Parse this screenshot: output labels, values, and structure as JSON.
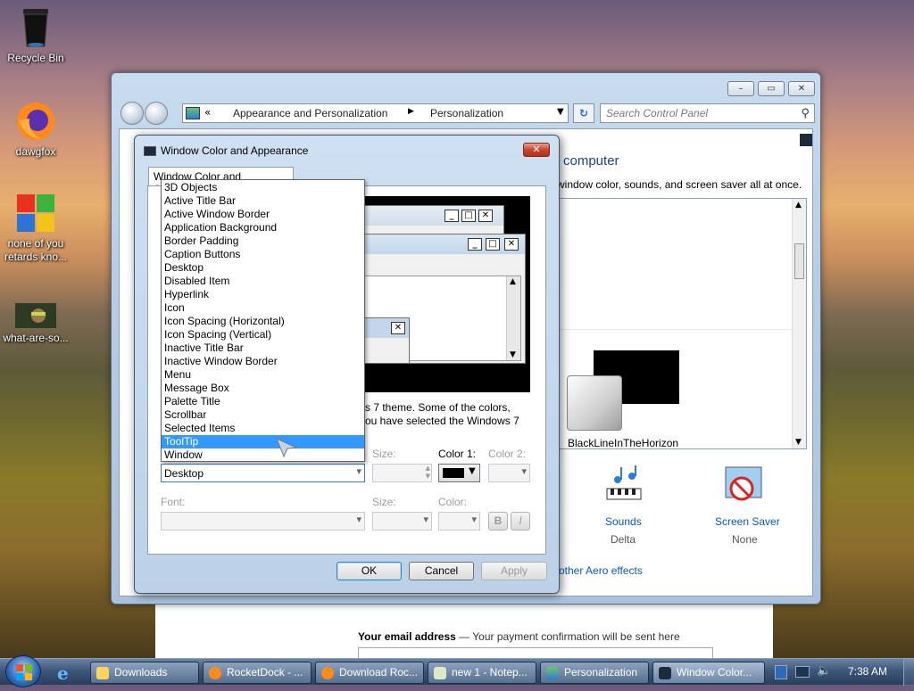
{
  "desktop": {
    "icons": [
      {
        "label": "Recycle Bin"
      },
      {
        "label": "dawgfox"
      },
      {
        "label": "none of you retards kno..."
      },
      {
        "label": "what-are-so..."
      }
    ]
  },
  "control_panel": {
    "breadcrumb_prefix": "«",
    "breadcrumb": [
      "Appearance and Personalization",
      "Personalization"
    ],
    "search_placeholder": "Search Control Panel",
    "heading_partial": "computer",
    "subtext_partial": "window color, sounds, and screen saver all at once.",
    "theme_name": "BlackLineInTheHorizon",
    "sounds_label": "Sounds",
    "sounds_value": "Delta",
    "screensaver_label": "Screen Saver",
    "screensaver_value": "None",
    "aero_link_partial": "other Aero effects"
  },
  "dialog": {
    "title": "Window Color and Appearance",
    "tab_label": "Window Color and Appearance",
    "description_line1": "s 7 theme.  Some of the colors,",
    "description_line2": "ou have selected the Windows 7",
    "item_selected": "Desktop",
    "item_options": [
      "3D Objects",
      "Active Title Bar",
      "Active Window Border",
      "Application Background",
      "Border Padding",
      "Caption Buttons",
      "Desktop",
      "Disabled Item",
      "Hyperlink",
      "Icon",
      "Icon Spacing (Horizontal)",
      "Icon Spacing (Vertical)",
      "Inactive Title Bar",
      "Inactive Window Border",
      "Menu",
      "Message Box",
      "Palette Title",
      "Scrollbar",
      "Selected Items",
      "ToolTip",
      "Window"
    ],
    "highlighted_option": "ToolTip",
    "size_label": "Size:",
    "color1_label": "Color 1:",
    "color2_label": "Color 2:",
    "font_label": "Font:",
    "font_size_label": "Size:",
    "font_color_label": "Color:",
    "bold_label": "B",
    "italic_label": "I",
    "ok_label": "OK",
    "cancel_label": "Cancel",
    "apply_label": "Apply",
    "color1_value": "#000000"
  },
  "webpage_behind": {
    "email_label": "Your email address",
    "email_hint": " — Your payment confirmation will be sent here"
  },
  "taskbar": {
    "tasks": [
      {
        "label": "Downloads"
      },
      {
        "label": "RocketDock - ..."
      },
      {
        "label": "Download Roc..."
      },
      {
        "label": "new  1 - Notep..."
      },
      {
        "label": "Personalization"
      },
      {
        "label": "Window Color..."
      }
    ],
    "clock": "7:38 AM"
  }
}
